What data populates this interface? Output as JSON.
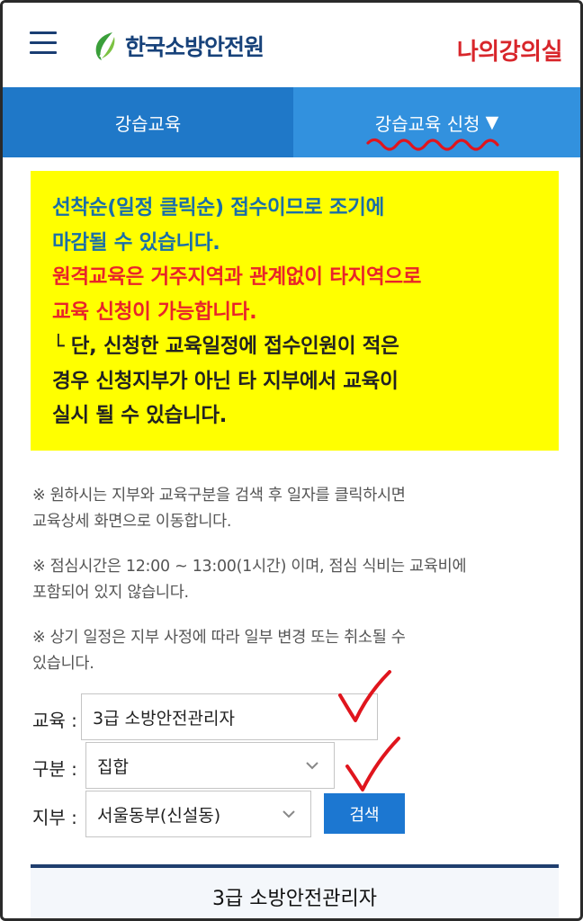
{
  "header": {
    "menu_icon": "hamburger-menu-icon",
    "logo_icon": "kfsi-leaf-logo-icon",
    "logo_text": "한국소방안전원",
    "my_course": "나의강의실"
  },
  "tabs": [
    {
      "label": "강습교육"
    },
    {
      "label": "강습교육 신청",
      "arrow": "▼"
    }
  ],
  "notice": {
    "blue_lines": [
      "선착순(일정 클릭순) 접수이므로 조기에",
      "마감될 수 있습니다."
    ],
    "red_lines": [
      "원격교육은 거주지역과 관계없이 타지역으로",
      "교육 신청이 가능합니다."
    ],
    "dark_lines": [
      "└ 단, 신청한 교육일정에 접수인원이 적은",
      "경우 신청지부가 아닌 타 지부에서 교육이",
      "실시 될 수 있습니다."
    ]
  },
  "info": [
    [
      "※ 원하시는 지부와 교육구분을 검색 후 일자를 클릭하시면",
      "교육상세 화면으로 이동합니다."
    ],
    [
      "※ 점심시간은 12:00 ~ 13:00(1시간) 이며, 점심 식비는 교육비에",
      "포함되어 있지 않습니다."
    ],
    [
      "※ 상기 일정은 지부 사정에 따라 일부 변경 또는 취소될 수",
      "있습니다."
    ]
  ],
  "form": {
    "education_label": "교육 :",
    "education_value": "3급 소방안전관리자",
    "type_label": "구분 :",
    "type_value": "집합",
    "branch_label": "지부 :",
    "branch_value": "서울동부(신설동)",
    "search_button": "검색"
  },
  "course_card": {
    "title": "3급 소방안전관리자"
  },
  "colors": {
    "brand_navy": "#17427a",
    "accent_red": "#d8262b",
    "tab_blue": "#1f78c8",
    "tab_blue_active": "#3291de",
    "notice_yellow": "#ffff00",
    "button_blue": "#1c77d1"
  }
}
